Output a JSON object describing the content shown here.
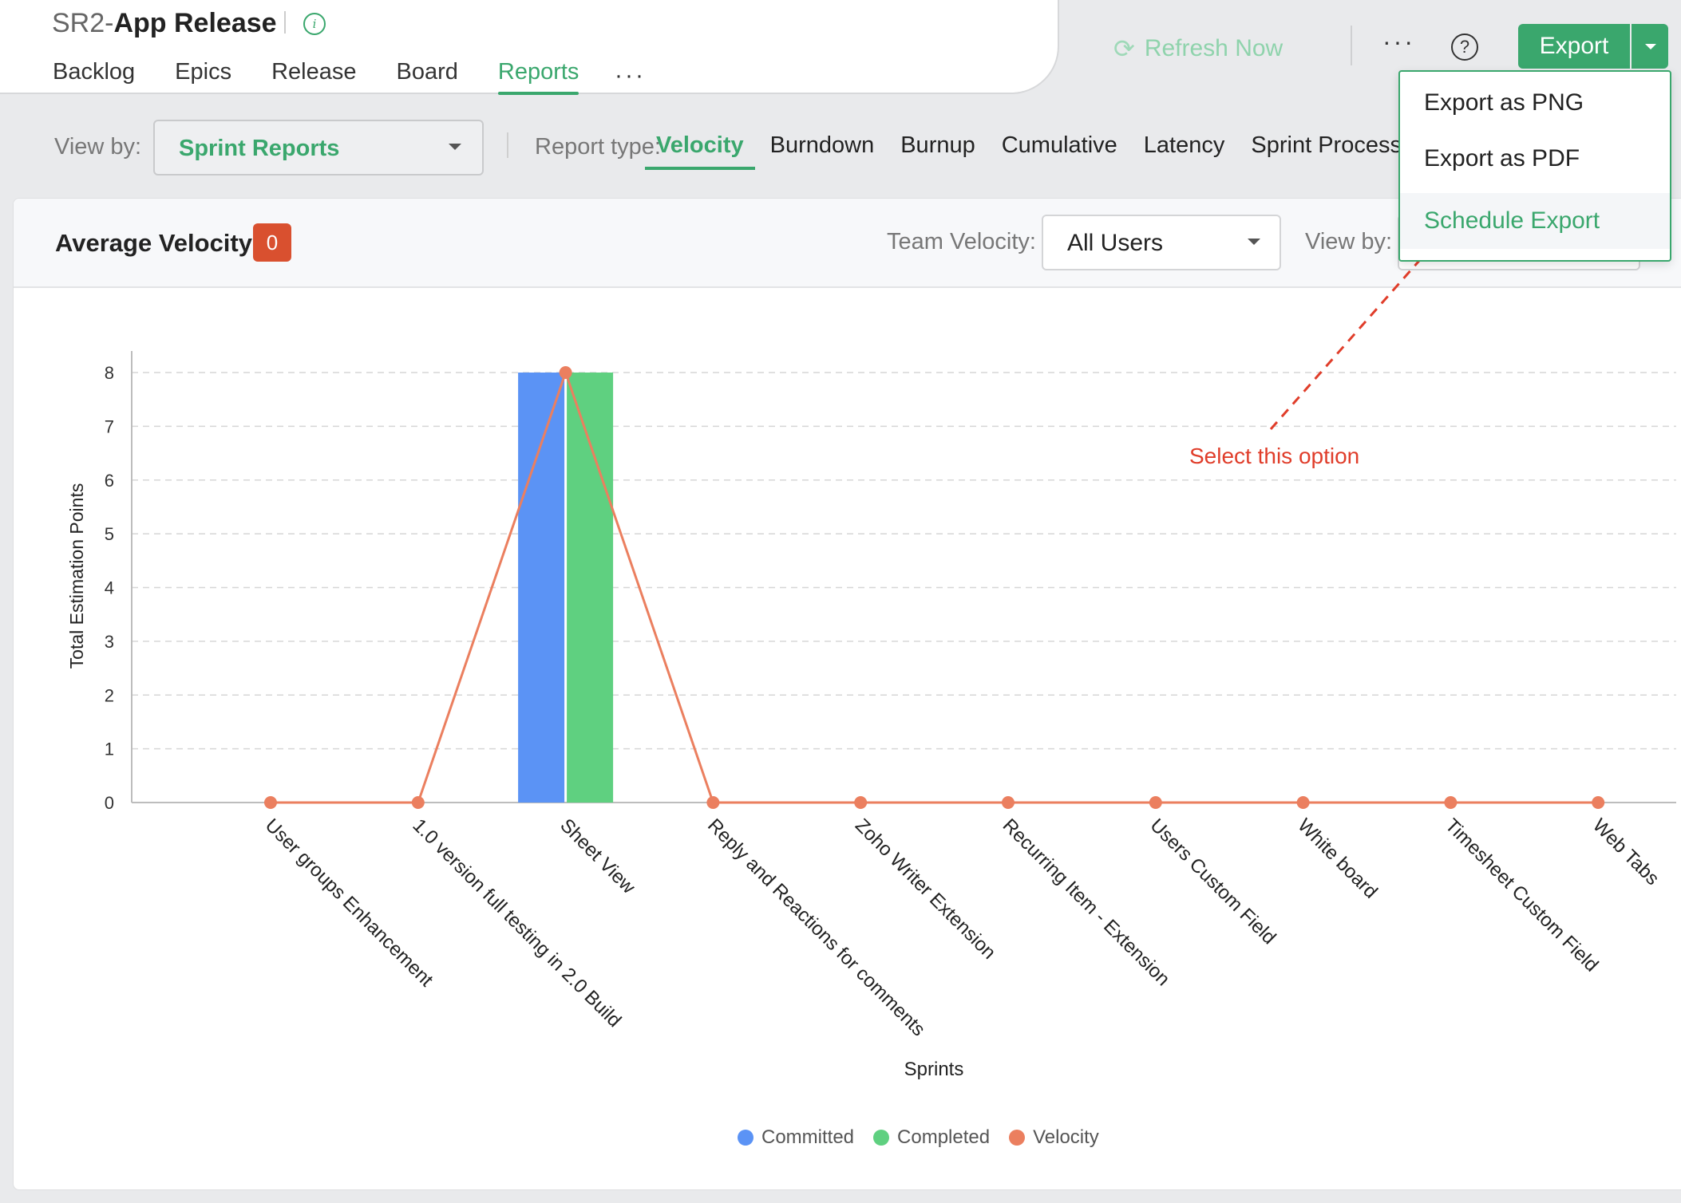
{
  "header": {
    "project_prefix": "SR2-",
    "project_name": "App Release",
    "nav": [
      {
        "label": "Backlog",
        "active": false
      },
      {
        "label": "Epics",
        "active": false
      },
      {
        "label": "Release",
        "active": false
      },
      {
        "label": "Board",
        "active": false
      },
      {
        "label": "Reports",
        "active": true
      }
    ],
    "nav_more": "···",
    "refresh_label": "Refresh Now",
    "more_label": "···",
    "help_label": "?",
    "export_label": "Export"
  },
  "export_menu": {
    "items": [
      "Export as PNG",
      "Export as PDF",
      "Schedule Export"
    ],
    "highlighted": "Schedule Export"
  },
  "filters": {
    "view_by_label": "View by:",
    "view_by_value": "Sprint Reports",
    "report_type_label": "Report type:",
    "report_types": [
      {
        "label": "Velocity",
        "active": true
      },
      {
        "label": "Burndown",
        "active": false
      },
      {
        "label": "Burnup",
        "active": false
      },
      {
        "label": "Cumulative",
        "active": false
      },
      {
        "label": "Latency",
        "active": false
      },
      {
        "label": "Sprint Process T",
        "active": false
      }
    ]
  },
  "panel": {
    "average_velocity_label": "Average Velocity:",
    "average_velocity_value": "0",
    "team_velocity_label": "Team Velocity:",
    "team_velocity_value": "All Users",
    "view_by_label": "View by:"
  },
  "annotation": {
    "text": "Select this option",
    "color": "#e03d2a"
  },
  "colors": {
    "accent": "#3aa76d",
    "badge": "#d9502f",
    "committed": "#5b93f5",
    "completed": "#5fd080",
    "velocity": "#eb7f5f"
  },
  "chart_data": {
    "type": "bar",
    "xlabel": "Sprints",
    "ylabel": "Total Estimation Points",
    "ylim": [
      0,
      8
    ],
    "yticks": [
      0,
      1,
      2,
      3,
      4,
      5,
      6,
      7,
      8
    ],
    "grid": true,
    "legend_position": "bottom",
    "categories": [
      "User groups Enhancement",
      "1.0 version full testing in 2.0 Build",
      "Sheet View",
      "Reply and Reactions for comments",
      "Zoho Writer Extension",
      "Recurring Item - Extension",
      "Users Custom Field",
      "White board",
      "Timesheet Custom Field",
      "Web Tabs"
    ],
    "series": [
      {
        "name": "Committed",
        "type": "bar",
        "values": [
          0,
          0,
          8,
          0,
          0,
          0,
          0,
          0,
          0,
          0
        ]
      },
      {
        "name": "Completed",
        "type": "bar",
        "values": [
          0,
          0,
          8,
          0,
          0,
          0,
          0,
          0,
          0,
          0
        ]
      },
      {
        "name": "Velocity",
        "type": "line",
        "values": [
          0,
          0,
          8,
          0,
          0,
          0,
          0,
          0,
          0,
          0
        ]
      }
    ]
  }
}
